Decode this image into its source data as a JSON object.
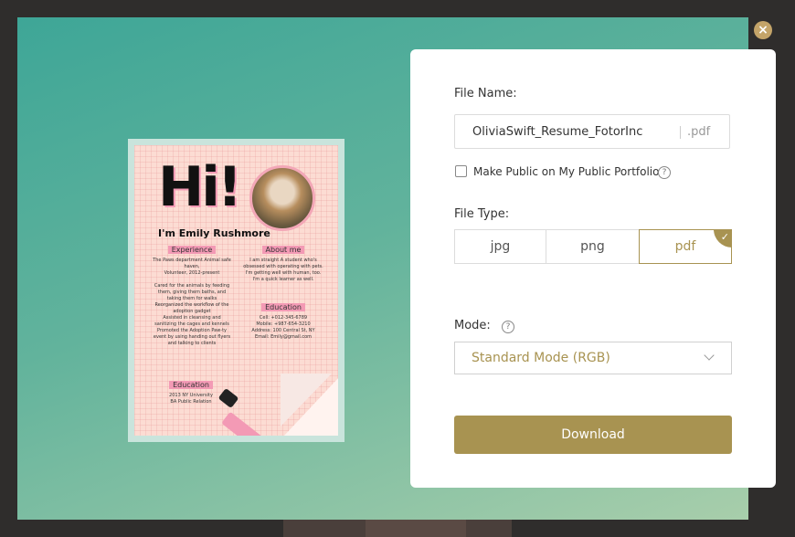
{
  "dialog": {
    "close_icon": "close-icon",
    "colors": {
      "accent": "#a89351",
      "modal_bg_start": "#3ea697",
      "modal_bg_end": "#a8ceab"
    }
  },
  "preview": {
    "headline": "Hi!",
    "name": "I'm Emily Rushmore",
    "experience": {
      "title": "Experience",
      "lines": [
        "The Paws department Animal safe",
        "haven,",
        "Volunteer, 2012-present",
        "",
        "Cared for the animals by feeding",
        "them, giving them baths, and",
        "taking them for walks",
        "Reorganized the workflow of the",
        "adoption gadget",
        "Assisted in cleansing and",
        "sanitizing the cages and kennels",
        "Promoted the Adoption Paw-ty",
        "event by using handing out flyers",
        "and talking to clients"
      ]
    },
    "about": {
      "title": "About me",
      "lines": [
        "I am straight A student who's",
        "obsessed with operating with pets.",
        "I'm getting well with human, too.",
        "I'm a quick learner as well."
      ]
    },
    "contact": {
      "title": "Education",
      "lines": [
        "Cell: +012-345-6789",
        "Mobile: +987-654-3210",
        "Address: 100 Central St, NY",
        "Email: Emily@gmail.com"
      ]
    },
    "education": {
      "title": "Education",
      "lines": [
        "2013 NY University",
        "BA Public Relation"
      ]
    }
  },
  "panel": {
    "file_name_label": "File Name:",
    "file_name_value": "OliviaSwift_Resume_FotorInc",
    "file_extension": ".pdf",
    "public_label": "Make Public on My Public Portfolio",
    "public_checked": false,
    "file_type_label": "File Type:",
    "file_types": [
      "jpg",
      "png",
      "pdf"
    ],
    "selected_type": "pdf",
    "mode_label": "Mode:",
    "mode_value": "Standard Mode (RGB)",
    "download_label": "Download"
  }
}
